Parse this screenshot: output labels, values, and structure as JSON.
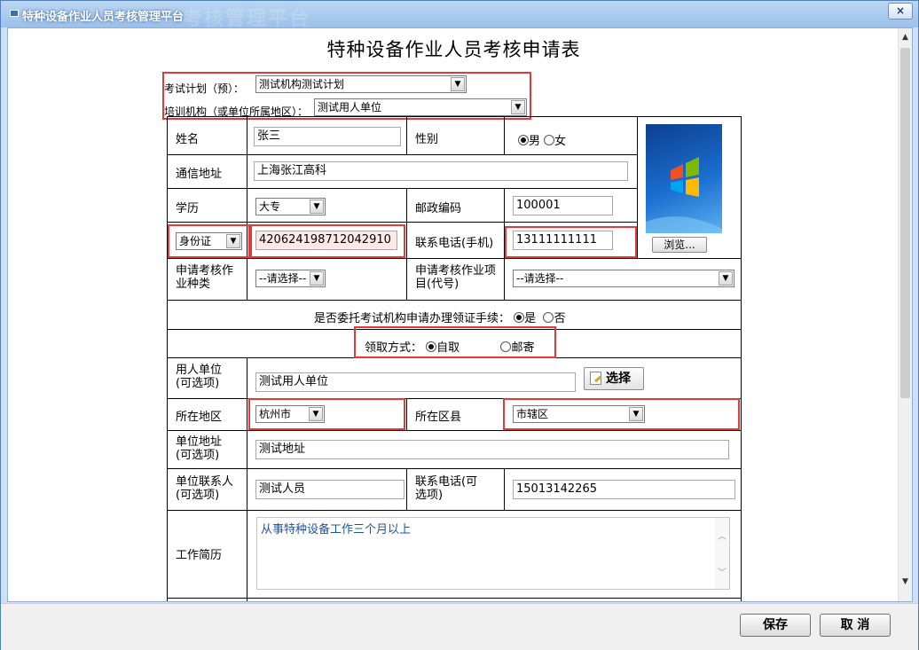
{
  "window": {
    "title": "特种设备作业人员考核管理平台",
    "title_ghost": "考核管理平台",
    "close_glyph": "×",
    "form_title": "特种设备作业人员考核申请表"
  },
  "header_fields": {
    "exam_plan_label": "考试计划（预）：",
    "exam_plan_value": "测试机构测试计划",
    "training_org_label": "培训机构（或单位所属地区）：",
    "training_org_value": "测试用人单位"
  },
  "form": {
    "name_label": "姓名",
    "name_value": "张三",
    "gender_label": "性别",
    "gender_male": "男",
    "gender_female": "女",
    "address_label": "通信地址",
    "address_value": "上海张江高科",
    "education_label": "学历",
    "education_value": "大专",
    "postcode_label": "邮政编码",
    "postcode_value": "100001",
    "id_type_value": "身份证",
    "id_number_value": "420624198712042910",
    "phone_label": "联系电话(手机)",
    "phone_value": "13111111111",
    "browse_label": "浏览...",
    "work_type_label": "申请考核作业种类",
    "work_type_value": "--请选择--",
    "work_item_label": "申请考核作业项目(代号)",
    "work_item_value": "--请选择--",
    "entrust_label": "是否委托考试机构申请办理领证手续：",
    "entrust_yes": "是",
    "entrust_no": "否",
    "pickup_label": "领取方式：",
    "pickup_self": "自取",
    "pickup_mail": "邮寄",
    "employer_label": "用人单位(可选项)",
    "employer_value": "测试用人单位",
    "select_button": "选择",
    "region_label": "所在地区",
    "region_value": "杭州市",
    "district_label": "所在区县",
    "district_value": "市辖区",
    "employer_address_label": "单位地址(可选项)",
    "employer_address_value": "测试地址",
    "contact_label": "单位联系人(可选项)",
    "contact_value": "测试人员",
    "contact_phone_label": "联系电话(可选项)",
    "contact_phone_value": "15013142265",
    "resume_label": "工作简历",
    "resume_value": "从事特种设备工作三个月以上"
  },
  "footer": {
    "save_label": "保存",
    "cancel_label": "取 消"
  }
}
